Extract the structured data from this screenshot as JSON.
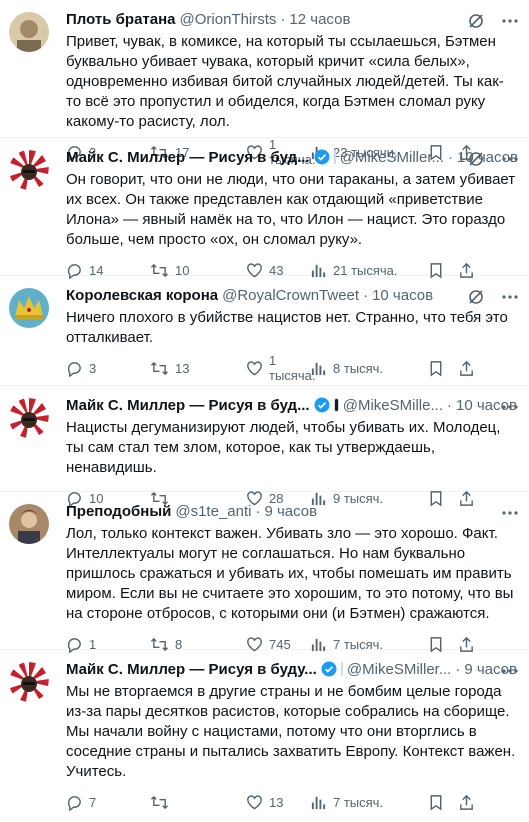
{
  "tweets": [
    {
      "author": "Плоть братана",
      "handle": "@OrionThirsts",
      "time": "12 часов",
      "text": "Привет, чувак, в комиксе, на который ты ссылаешься, Бэтмен буквально убивает чувака, который кричит «сила белых», одновременно избивая битой случайных людей/детей. Ты как-то всё это пропустил и обиделся, когда Бэтмен сломал руку какому-то расисту, лол.",
      "replies": "3",
      "retweets": "17",
      "likes": "",
      "likes_label": "1 тысяча.",
      "views": "23 тысячи.",
      "avatar_color": "#c9b89a",
      "verified": false
    },
    {
      "author": "Майк С. Миллер — Рисуя в буд...",
      "handle": "@MikeSMiller...",
      "time": "10 часов",
      "text": "Он говорит, что они не люди, что они тараканы, а затем убивает их всех. Он также представлен как отдающий «приветствие Илона» — явный намёк на то, что Илон — нацист. Это гораздо больше, чем просто «ох, он сломал руку».",
      "replies": "14",
      "retweets": "10",
      "likes": "43",
      "views": "21 тысяча.",
      "avatar_color": "#b3212b",
      "verified": true
    },
    {
      "author": "Королевская корона",
      "handle": "@RoyalCrownTweet",
      "time": "10 часов",
      "text": "Ничего плохого в убийстве нацистов нет. Странно, что тебя это отталкивает.",
      "replies": "3",
      "retweets": "13",
      "likes": "",
      "likes_label": "1 тысяча.",
      "views": "8 тысяч.",
      "avatar_color": "#2f7f4f",
      "verified": false
    },
    {
      "author": "Майк С. Миллер — Рисуя в буд...",
      "handle": "@MikeSMille...",
      "time": "10 часов",
      "text": "Нацисты дегуманизируют людей, чтобы убивать их. Молодец, ты сам стал тем злом, которое, как ты утверждаешь, ненавидишь.",
      "replies": "10",
      "retweets": "",
      "likes": "28",
      "views": "9 тысяч.",
      "avatar_color": "#b3212b",
      "verified": true
    },
    {
      "author": "Преподобный",
      "handle": "@s1te_anti",
      "time": "9 часов",
      "text": "Лол, только контекст важен. Убивать зло — это хорошо. Факт. Интеллектуалы могут не соглашаться. Но нам буквально пришлось сражаться и убивать их, чтобы помешать им править миром. Если вы не считаете это хорошим, то это потому, что вы на стороне отбросов, с которыми они (и Бэтмен) сражаются.",
      "replies": "1",
      "retweets": "8",
      "likes": "745",
      "views": "7 тысяч.",
      "avatar_color": "#8a6a4a",
      "verified": false
    },
    {
      "author": "Майк С. Миллер — Рисуя в буду...",
      "handle": "@MikeSMiller...",
      "time": "9 часов",
      "text": "Мы не вторгаемся в другие страны и не бомбим целые города из-за пары десятков расистов, которые собрались на сборище. Мы начали войну с нацистами, потому что они вторглись в соседние страны и пытались захватить Европу. Контекст важен. Учитесь.",
      "replies": "7",
      "retweets": "",
      "likes": "13",
      "views": "7 тысяч.",
      "avatar_color": "#b3212b",
      "verified": true
    }
  ],
  "colors": {
    "text": "#0f1419",
    "muted": "#536471",
    "verified": "#1d9bf0",
    "divider": "#eff3f4"
  }
}
